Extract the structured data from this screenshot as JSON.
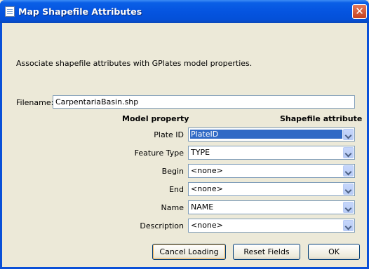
{
  "window": {
    "title": "Map Shapefile Attributes",
    "close_glyph": "✕"
  },
  "intro_text": "Associate shapefile attributes with GPlates model properties.",
  "filename": {
    "label": "Filename:",
    "value": "CarpentariaBasin.shp"
  },
  "headers": {
    "model_property": "Model property",
    "shapefile_attribute": "Shapefile attribute"
  },
  "rows": [
    {
      "label": "Plate ID",
      "value": "PlateID",
      "selected": true
    },
    {
      "label": "Feature Type",
      "value": "TYPE"
    },
    {
      "label": "Begin",
      "value": "<none>"
    },
    {
      "label": "End",
      "value": "<none>"
    },
    {
      "label": "Name",
      "value": "NAME"
    },
    {
      "label": "Description",
      "value": "<none>"
    }
  ],
  "buttons": {
    "cancel": "Cancel Loading",
    "reset": "Reset Fields",
    "ok": "OK"
  },
  "colors": {
    "title_bar": "#0554e0",
    "selection": "#316ac5",
    "dialog_bg": "#ece9d8"
  }
}
